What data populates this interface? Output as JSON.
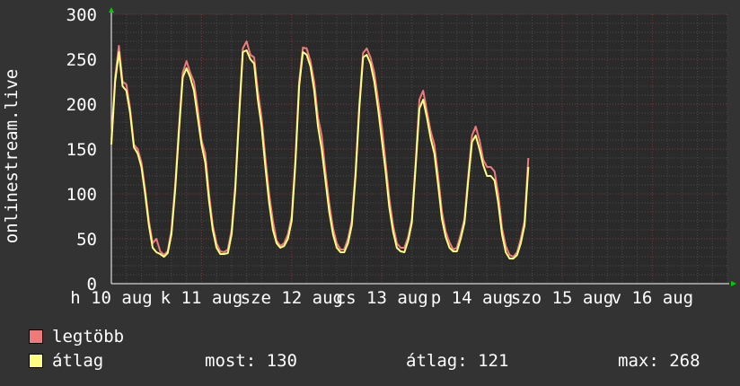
{
  "chart_data": {
    "type": "line",
    "ylabel": "onlinestream.live",
    "ylim": [
      0,
      300
    ],
    "yticks": [
      0,
      50,
      100,
      150,
      200,
      250,
      300
    ],
    "xlim": [
      0,
      164
    ],
    "xtick_labels": [
      {
        "label": "h 10 aug",
        "x": 0
      },
      {
        "label": "k 11 aug",
        "x": 24
      },
      {
        "label": "sze 12 aug",
        "x": 48
      },
      {
        "label": "cs 13 aug",
        "x": 72
      },
      {
        "label": "p 14 aug",
        "x": 96
      },
      {
        "label": "szo 15 aug",
        "x": 120
      },
      {
        "label": "v 16 aug",
        "x": 144
      }
    ],
    "grid": true,
    "series": [
      {
        "name": "legtöbb",
        "color": "#f07a7a",
        "points": [
          [
            0,
            160
          ],
          [
            1,
            230
          ],
          [
            2,
            265
          ],
          [
            3,
            225
          ],
          [
            4,
            222
          ],
          [
            5,
            195
          ],
          [
            6,
            155
          ],
          [
            7,
            150
          ],
          [
            8,
            135
          ],
          [
            9,
            105
          ],
          [
            10,
            70
          ],
          [
            11,
            45
          ],
          [
            12,
            50
          ],
          [
            13,
            36
          ],
          [
            14,
            32
          ],
          [
            15,
            36
          ],
          [
            16,
            60
          ],
          [
            17,
            110
          ],
          [
            18,
            175
          ],
          [
            19,
            235
          ],
          [
            20,
            248
          ],
          [
            21,
            235
          ],
          [
            22,
            225
          ],
          [
            23,
            195
          ],
          [
            24,
            160
          ],
          [
            25,
            145
          ],
          [
            26,
            100
          ],
          [
            27,
            65
          ],
          [
            28,
            45
          ],
          [
            29,
            36
          ],
          [
            30,
            35
          ],
          [
            31,
            38
          ],
          [
            32,
            60
          ],
          [
            33,
            110
          ],
          [
            34,
            190
          ],
          [
            35,
            262
          ],
          [
            36,
            270
          ],
          [
            37,
            255
          ],
          [
            38,
            252
          ],
          [
            39,
            215
          ],
          [
            40,
            185
          ],
          [
            41,
            140
          ],
          [
            42,
            100
          ],
          [
            43,
            70
          ],
          [
            44,
            48
          ],
          [
            45,
            42
          ],
          [
            46,
            45
          ],
          [
            47,
            55
          ],
          [
            48,
            75
          ],
          [
            49,
            140
          ],
          [
            50,
            225
          ],
          [
            51,
            263
          ],
          [
            52,
            262
          ],
          [
            53,
            248
          ],
          [
            54,
            225
          ],
          [
            55,
            185
          ],
          [
            56,
            165
          ],
          [
            57,
            125
          ],
          [
            58,
            90
          ],
          [
            59,
            62
          ],
          [
            60,
            45
          ],
          [
            61,
            38
          ],
          [
            62,
            38
          ],
          [
            63,
            50
          ],
          [
            64,
            70
          ],
          [
            65,
            125
          ],
          [
            66,
            200
          ],
          [
            67,
            257
          ],
          [
            68,
            262
          ],
          [
            69,
            252
          ],
          [
            70,
            235
          ],
          [
            71,
            205
          ],
          [
            72,
            175
          ],
          [
            73,
            135
          ],
          [
            74,
            95
          ],
          [
            75,
            65
          ],
          [
            76,
            45
          ],
          [
            77,
            40
          ],
          [
            78,
            40
          ],
          [
            79,
            52
          ],
          [
            80,
            72
          ],
          [
            81,
            135
          ],
          [
            82,
            205
          ],
          [
            83,
            215
          ],
          [
            84,
            192
          ],
          [
            85,
            170
          ],
          [
            86,
            155
          ],
          [
            87,
            120
          ],
          [
            88,
            80
          ],
          [
            89,
            58
          ],
          [
            90,
            46
          ],
          [
            91,
            38
          ],
          [
            92,
            40
          ],
          [
            93,
            55
          ],
          [
            94,
            72
          ],
          [
            95,
            120
          ],
          [
            96,
            165
          ],
          [
            97,
            175
          ],
          [
            98,
            160
          ],
          [
            99,
            138
          ],
          [
            100,
            130
          ],
          [
            101,
            130
          ],
          [
            102,
            125
          ],
          [
            103,
            100
          ],
          [
            104,
            62
          ],
          [
            105,
            42
          ],
          [
            106,
            32
          ],
          [
            107,
            30
          ],
          [
            108,
            35
          ],
          [
            109,
            50
          ],
          [
            110,
            70
          ],
          [
            111,
            140
          ]
        ]
      },
      {
        "name": "átlag",
        "color": "#ffff80",
        "points": [
          [
            0,
            155
          ],
          [
            1,
            225
          ],
          [
            2,
            258
          ],
          [
            3,
            220
          ],
          [
            4,
            215
          ],
          [
            5,
            190
          ],
          [
            6,
            152
          ],
          [
            7,
            145
          ],
          [
            8,
            130
          ],
          [
            9,
            100
          ],
          [
            10,
            65
          ],
          [
            11,
            40
          ],
          [
            12,
            35
          ],
          [
            13,
            33
          ],
          [
            14,
            30
          ],
          [
            15,
            34
          ],
          [
            16,
            55
          ],
          [
            17,
            105
          ],
          [
            18,
            170
          ],
          [
            19,
            230
          ],
          [
            20,
            240
          ],
          [
            21,
            230
          ],
          [
            22,
            215
          ],
          [
            23,
            185
          ],
          [
            24,
            155
          ],
          [
            25,
            135
          ],
          [
            26,
            92
          ],
          [
            27,
            60
          ],
          [
            28,
            40
          ],
          [
            29,
            33
          ],
          [
            30,
            33
          ],
          [
            31,
            34
          ],
          [
            32,
            55
          ],
          [
            33,
            105
          ],
          [
            34,
            185
          ],
          [
            35,
            258
          ],
          [
            36,
            260
          ],
          [
            37,
            250
          ],
          [
            38,
            245
          ],
          [
            39,
            205
          ],
          [
            40,
            175
          ],
          [
            41,
            130
          ],
          [
            42,
            90
          ],
          [
            43,
            60
          ],
          [
            44,
            45
          ],
          [
            45,
            40
          ],
          [
            46,
            42
          ],
          [
            47,
            50
          ],
          [
            48,
            70
          ],
          [
            49,
            135
          ],
          [
            50,
            220
          ],
          [
            51,
            258
          ],
          [
            52,
            255
          ],
          [
            53,
            242
          ],
          [
            54,
            215
          ],
          [
            55,
            175
          ],
          [
            56,
            150
          ],
          [
            57,
            115
          ],
          [
            58,
            80
          ],
          [
            59,
            55
          ],
          [
            60,
            40
          ],
          [
            61,
            35
          ],
          [
            62,
            35
          ],
          [
            63,
            45
          ],
          [
            64,
            65
          ],
          [
            65,
            120
          ],
          [
            66,
            195
          ],
          [
            67,
            252
          ],
          [
            68,
            255
          ],
          [
            69,
            245
          ],
          [
            70,
            225
          ],
          [
            71,
            195
          ],
          [
            72,
            160
          ],
          [
            73,
            125
          ],
          [
            74,
            85
          ],
          [
            75,
            58
          ],
          [
            76,
            40
          ],
          [
            77,
            36
          ],
          [
            78,
            35
          ],
          [
            79,
            48
          ],
          [
            80,
            68
          ],
          [
            81,
            130
          ],
          [
            82,
            195
          ],
          [
            83,
            205
          ],
          [
            84,
            185
          ],
          [
            85,
            162
          ],
          [
            86,
            145
          ],
          [
            87,
            110
          ],
          [
            88,
            72
          ],
          [
            89,
            52
          ],
          [
            90,
            40
          ],
          [
            91,
            36
          ],
          [
            92,
            36
          ],
          [
            93,
            50
          ],
          [
            94,
            68
          ],
          [
            95,
            115
          ],
          [
            96,
            158
          ],
          [
            97,
            165
          ],
          [
            98,
            150
          ],
          [
            99,
            132
          ],
          [
            100,
            120
          ],
          [
            101,
            120
          ],
          [
            102,
            115
          ],
          [
            103,
            90
          ],
          [
            104,
            55
          ],
          [
            105,
            35
          ],
          [
            106,
            28
          ],
          [
            107,
            28
          ],
          [
            108,
            32
          ],
          [
            109,
            45
          ],
          [
            110,
            65
          ],
          [
            111,
            130
          ]
        ]
      }
    ]
  },
  "legend": [
    {
      "label": "legtöbb",
      "color": "#f07a7a"
    },
    {
      "label": "átlag",
      "color": "#ffff80"
    }
  ],
  "stats": {
    "most": "most: 130",
    "atlag": "átlag: 121",
    "max": "max: 268"
  }
}
